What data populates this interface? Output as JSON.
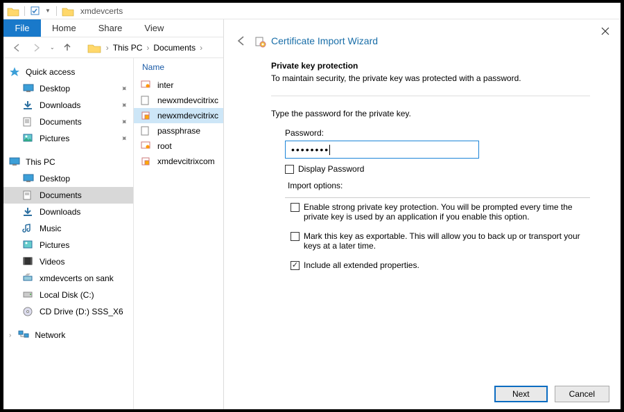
{
  "window": {
    "title": "xmdevcerts"
  },
  "ribbon": {
    "file": "File",
    "home": "Home",
    "share": "Share",
    "view": "View"
  },
  "breadcrumb": {
    "segments": [
      "This PC",
      "Documents"
    ]
  },
  "navpane": {
    "quick_access": {
      "label": "Quick access",
      "items": [
        {
          "label": "Desktop",
          "pinned": true
        },
        {
          "label": "Downloads",
          "pinned": true
        },
        {
          "label": "Documents",
          "pinned": true
        },
        {
          "label": "Pictures",
          "pinned": true
        }
      ]
    },
    "this_pc": {
      "label": "This PC",
      "items": [
        {
          "label": "Desktop"
        },
        {
          "label": "Documents",
          "selected": true
        },
        {
          "label": "Downloads"
        },
        {
          "label": "Music"
        },
        {
          "label": "Pictures"
        },
        {
          "label": "Videos"
        },
        {
          "label": "xmdevcerts on sank"
        },
        {
          "label": "Local Disk (C:)"
        },
        {
          "label": "CD Drive (D:) SSS_X6"
        }
      ]
    },
    "network": {
      "label": "Network"
    }
  },
  "filelist": {
    "column_header": "Name",
    "items": [
      {
        "name": "inter",
        "icon": "cert",
        "selected": false
      },
      {
        "name": "newxmdevcitrixc",
        "icon": "txt",
        "selected": false
      },
      {
        "name": "newxmdevcitrixc",
        "icon": "pfx",
        "selected": true
      },
      {
        "name": "passphrase",
        "icon": "txt",
        "selected": false
      },
      {
        "name": "root",
        "icon": "cert",
        "selected": false
      },
      {
        "name": "xmdevcitrixcom",
        "icon": "pfx",
        "selected": false
      }
    ]
  },
  "wizard": {
    "title": "Certificate Import Wizard",
    "section_title": "Private key protection",
    "section_sub": "To maintain security, the private key was protected with a password.",
    "prompt": "Type the password for the private key.",
    "password_label": "Password:",
    "password_value": "••••••••",
    "display_password_label": "Display Password",
    "import_options_label": "Import options:",
    "opt_strong": "Enable strong private key protection. You will be prompted every time the private key is used by an application if you enable this option.",
    "opt_exportable": "Mark this key as exportable. This will allow you to back up or transport your keys at a later time.",
    "opt_extended": "Include all extended properties.",
    "buttons": {
      "next": "Next",
      "cancel": "Cancel"
    }
  }
}
